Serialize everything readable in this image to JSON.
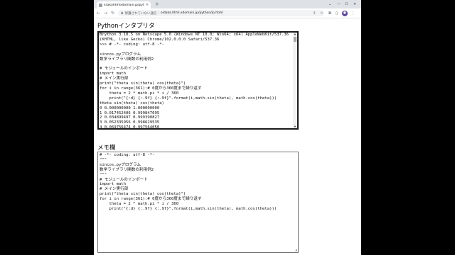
{
  "browser": {
    "tab_title": "ssakahtmlxdomain.jp/pytho",
    "new_tab": "+",
    "security_label": "保護されていない通信",
    "url": "oidaka.html.xdomain.jp/python/ip.html"
  },
  "page": {
    "title": "Pythonインタプリタ",
    "console_lines": [
      "Brython 3.10.5 on Netscape 5.0 (Windows NT 10.0; Win64; x64) AppleWebKit/537.36",
      "(KHTML, like Gecko) Chrome/102.0.0.0 Safari/537.36",
      ">>> # -*- coding: utf-8 -*-",
      "",
      "sincos.pyプログラム",
      "数学ライブラリ関数の利用例2",
      "",
      "# モジュールのインポート",
      "import math",
      "# メイン実行部",
      "print(\"theta sin(theta) cos(theta)\")",
      "for i in range(361):# 0度から360度まで繰り返す",
      "    theta = 2 * math.pi * i / 360",
      "    print(\"{:d} {:.9f} {:.9f}\".format(i,math.sin(theta), math.cos(theta)))",
      "theta sin(theta) cos(theta)",
      "0 0.000000000 1.000000000",
      "1 0.017452406 0.999847695",
      "2 0.034899497 0.999390827",
      "3 0.052335956 0.998629535",
      "4 0.069756474 0.997564050"
    ],
    "memo_title": "メモ欄",
    "memo_lines": [
      "# -*- coding: utf-8 -*-",
      "\"\"\"",
      "sincos.pyプログラム",
      "数学ライブラリ関数の利用例2",
      "\"\"\"",
      "# モジュールのインポート",
      "import math",
      "# メイン実行部",
      "print(\"theta sin(theta) cos(theta)\")",
      "for i in range(361):# 0度から360度まで繰り返す",
      "    theta = 2 * math.pi * i / 360",
      "    print(\"{:d} {:.9f} {:.9f}\".format(i,math.sin(theta), math.cos(theta)))"
    ]
  },
  "colors": {
    "page_background": "#000000",
    "tabstrip": "#dee1e6",
    "avatar": "#5e4a9e"
  }
}
